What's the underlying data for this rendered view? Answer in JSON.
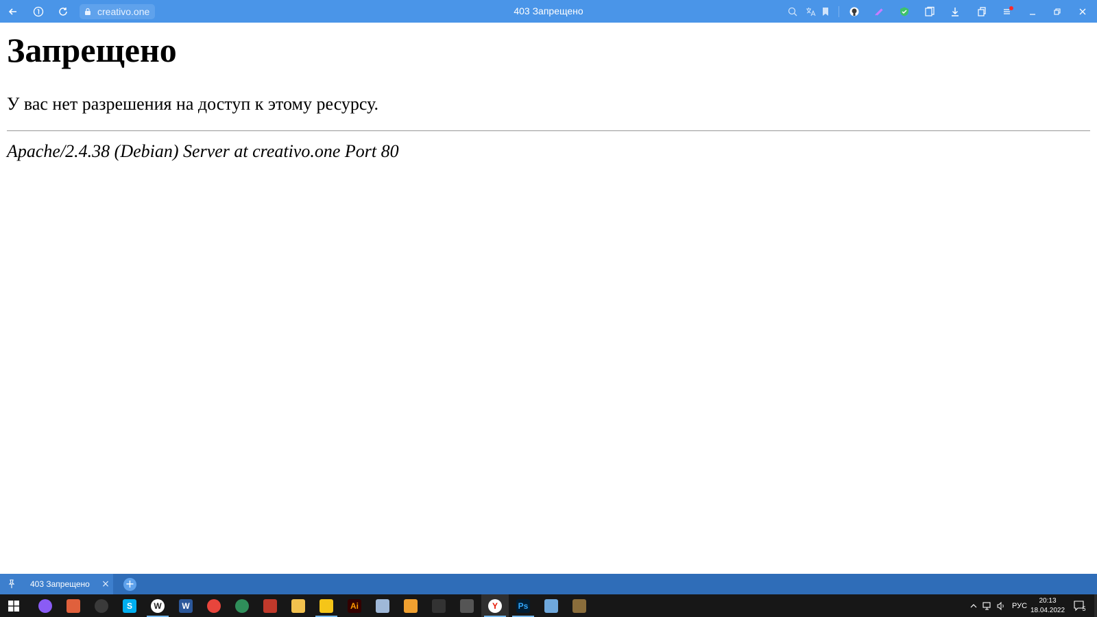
{
  "browser": {
    "url": "creativo.one",
    "tab_title": "403 Запрещено"
  },
  "page": {
    "heading": "Запрещено",
    "message": "У вас нет разрешения на доступ к этому ресурсу.",
    "server_signature": "Apache/2.4.38 (Debian) Server at creativo.one Port 80"
  },
  "tabbar": {
    "tab_label": "403 Запрещено",
    "close_glyph": "×",
    "new_tab_glyph": "+"
  },
  "taskbar": {
    "language": "РУС",
    "time": "20:13",
    "date": "18.04.2022",
    "notification_count": "5",
    "apps": [
      {
        "name": "alice-icon",
        "letter": "",
        "color": "#8a5cf5"
      },
      {
        "name": "paint-icon",
        "letter": "",
        "color": "#e0603c"
      },
      {
        "name": "obs-icon",
        "letter": "",
        "color": "#3a3a3a"
      },
      {
        "name": "skype-icon",
        "letter": "S",
        "color": "#00aff0"
      },
      {
        "name": "webstorm-icon",
        "letter": "W",
        "color": "#ffffff"
      },
      {
        "name": "word-icon",
        "letter": "W",
        "color": "#2b579a"
      },
      {
        "name": "chrome-icon",
        "letter": "",
        "color": "#e8453c"
      },
      {
        "name": "vpn-globe-icon",
        "letter": "",
        "color": "#2f8e5a"
      },
      {
        "name": "archiver-icon",
        "letter": "",
        "color": "#c0392b"
      },
      {
        "name": "file-explorer-icon",
        "letter": "",
        "color": "#f2c14e"
      },
      {
        "name": "sticky-app-icon",
        "letter": "",
        "color": "#f5c518"
      },
      {
        "name": "illustrator-icon",
        "letter": "Ai",
        "color": "#330000"
      },
      {
        "name": "notepad-icon",
        "letter": "",
        "color": "#9fb8d8"
      },
      {
        "name": "media-player-icon",
        "letter": "",
        "color": "#f0a030"
      },
      {
        "name": "gamepad-icon",
        "letter": "",
        "color": "#333333"
      },
      {
        "name": "camera-app-icon",
        "letter": "",
        "color": "#555555"
      },
      {
        "name": "yandex-browser-icon",
        "letter": "Y",
        "color": "#ffffff"
      },
      {
        "name": "photoshop-icon",
        "letter": "Ps",
        "color": "#001e36"
      },
      {
        "name": "image-viewer-icon",
        "letter": "",
        "color": "#6fa8dc"
      },
      {
        "name": "game-icon",
        "letter": "",
        "color": "#8a6d3b"
      }
    ]
  }
}
